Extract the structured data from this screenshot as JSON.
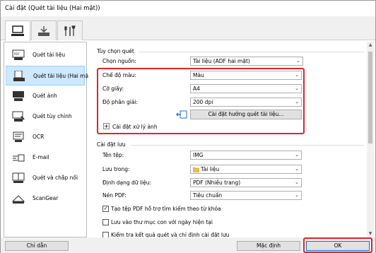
{
  "window": {
    "title": "Cài đặt (Quét tài liệu (Hai mặt))"
  },
  "tabs": [
    {
      "icon": "scan-from-computer-icon",
      "active": true
    },
    {
      "icon": "scan-from-panel-icon",
      "active": false
    },
    {
      "icon": "general-settings-icon",
      "active": false
    }
  ],
  "sidebar": {
    "items": [
      {
        "label": "Quét tài liệu",
        "icon": "document-scan-icon",
        "selected": false
      },
      {
        "label": "Quét tài liệu (Hai mặt)",
        "icon": "duplex-scan-icon",
        "selected": true
      },
      {
        "label": "Quét ảnh",
        "icon": "photo-scan-icon",
        "selected": false
      },
      {
        "label": "Quét tùy chỉnh",
        "icon": "custom-scan-icon",
        "selected": false
      },
      {
        "label": "OCR",
        "icon": "ocr-icon",
        "selected": false
      },
      {
        "label": "E-mail",
        "icon": "email-icon",
        "selected": false
      },
      {
        "label": "Quét và chắp nối",
        "icon": "stitch-icon",
        "selected": false
      },
      {
        "label": "ScanGear",
        "icon": "scangear-icon",
        "selected": false
      }
    ]
  },
  "scan_options": {
    "group_title": "Tùy chọn quét",
    "source_label": "Chọn nguồn:",
    "source_value": "Tài liệu (ADF hai mặt)",
    "color_mode_label": "Chế độ màu:",
    "color_mode_value": "Màu",
    "paper_size_label": "Cỡ giấy:",
    "paper_size_value": "A4",
    "resolution_label": "Độ phân giải:",
    "resolution_value": "200 dpi",
    "scan_settings_button": "Cài đặt hướng quét tài liệu...",
    "image_processing_label": "Cài đặt xử lý ảnh",
    "expand_symbol": "+"
  },
  "save_settings": {
    "group_title": "Cài đặt lưu",
    "file_name_label": "Tên tệp:",
    "file_name_value": "IMG",
    "save_in_label": "Lưu trong:",
    "save_in_value": "Tài liệu",
    "data_format_label": "Định dạng dữ liệu:",
    "data_format_value": "PDF (Nhiều trang)",
    "pdf_compression_label": "Nén PDF:",
    "pdf_compression_value": "Tiêu chuẩn",
    "checkboxes": [
      {
        "label": "Tạo tệp PDF hỗ trợ tìm kiếm theo từ khóa",
        "checked": true
      },
      {
        "label": "Lưu vào thư mục con với ngày hiện tại",
        "checked": false
      },
      {
        "label": "Kiểm tra kết quả quét và chỉ định cài đặt lưu",
        "checked": false
      }
    ]
  },
  "footer": {
    "guide_button": "Chỉ dẫn",
    "defaults_button": "Mặc định",
    "ok_button": "OK"
  },
  "colors": {
    "highlight": "#e0242a",
    "selected_bg": "#cde8ff"
  }
}
